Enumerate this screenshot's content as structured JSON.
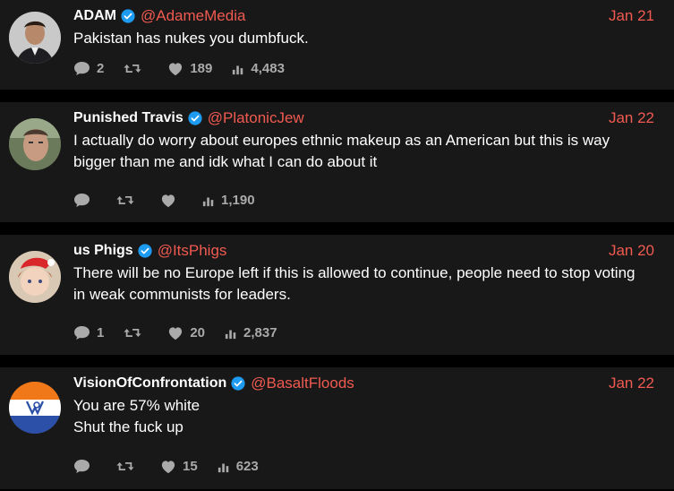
{
  "colors": {
    "accent": "#f05a50",
    "verified": "#1d9bf0",
    "background": "#181818"
  },
  "tweets": [
    {
      "name": "ADAM",
      "handle": "@AdameMedia",
      "date": "Jan 21",
      "text": "Pakistan has nukes you dumbfuck.",
      "replies": "2",
      "retweets": "",
      "likes": "189",
      "views": "4,483"
    },
    {
      "name": "Punished Travis",
      "handle": "@PlatonicJew",
      "date": "Jan 22",
      "text": "I actually do worry about europes ethnic makeup as an American but this is way bigger than me and idk what I can do about it",
      "replies": "",
      "retweets": "",
      "likes": "",
      "views": "1,190"
    },
    {
      "name": "us Phigs",
      "handle": "@ItsPhigs",
      "date": "Jan 20",
      "text": "There will be no Europe left if this is allowed to continue, people need to stop voting in weak communists for leaders.",
      "replies": "1",
      "retweets": "",
      "likes": "20",
      "views": "2,837"
    },
    {
      "name": "VisionOfConfrontation",
      "handle": "@BasaltFloods",
      "date": "Jan 22",
      "text": "You are 57% white\nShut the fuck up",
      "replies": "",
      "retweets": "",
      "likes": "15",
      "views": "623"
    }
  ],
  "icons": [
    "reply-icon",
    "retweet-icon",
    "like-icon",
    "views-icon",
    "verified-badge-icon"
  ]
}
